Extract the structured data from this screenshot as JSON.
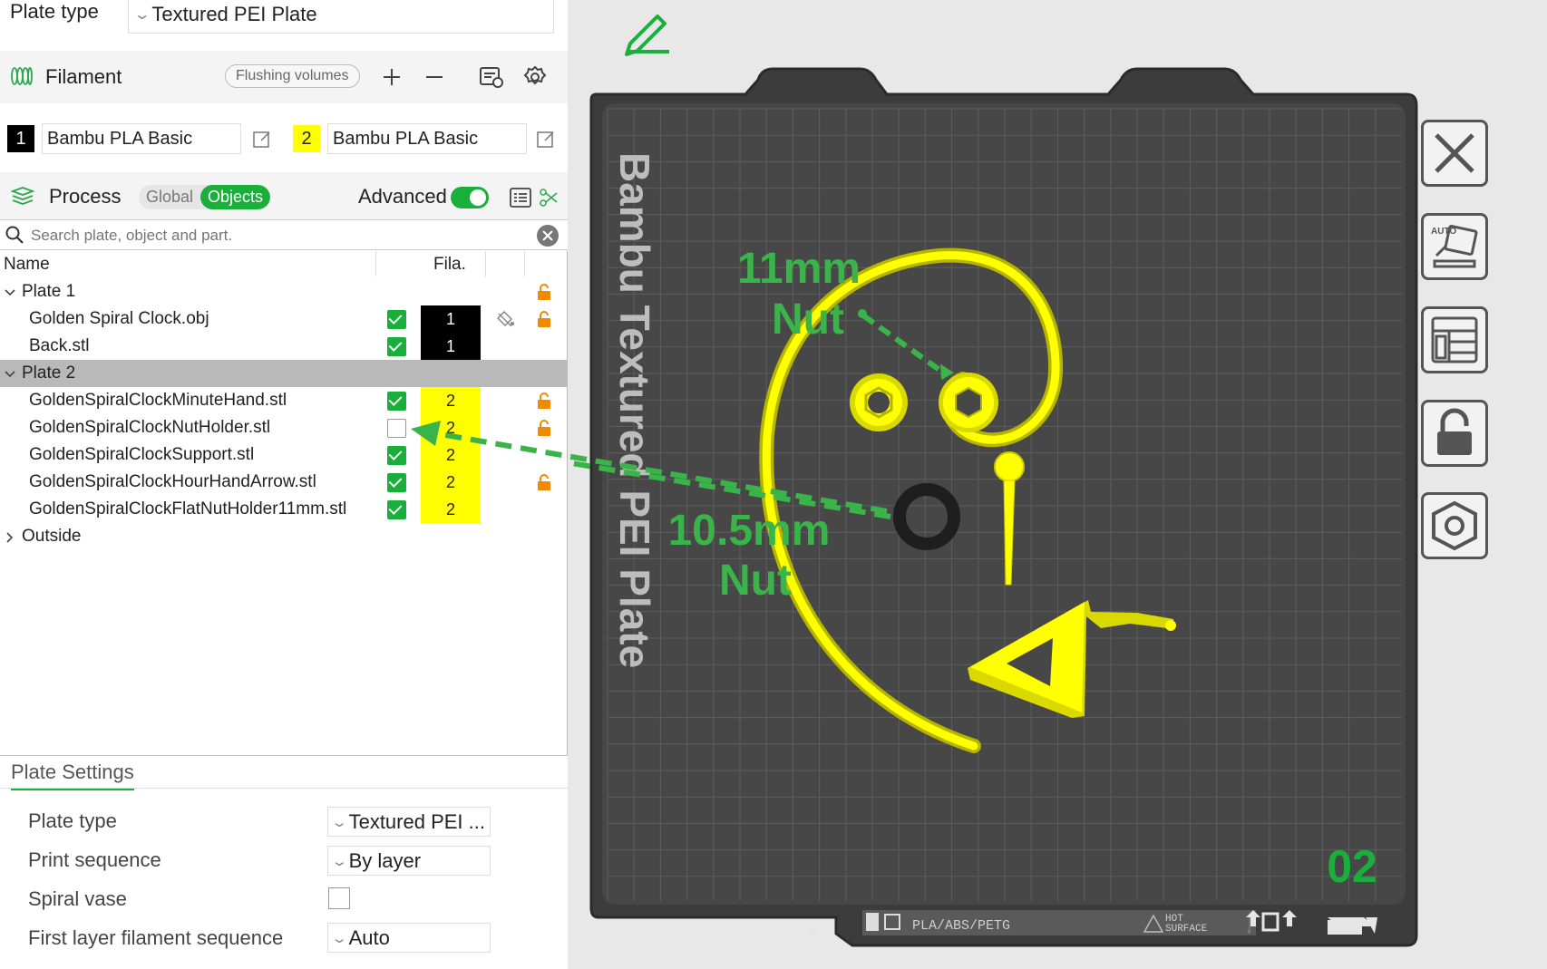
{
  "plate_type_top": {
    "label": "Plate type",
    "value": "Textured PEI Plate"
  },
  "filament": {
    "title": "Filament",
    "flushing_label": "Flushing volumes",
    "items": [
      {
        "index": "1",
        "name": "Bambu PLA Basic",
        "color": "#000000"
      },
      {
        "index": "2",
        "name": "Bambu PLA Basic",
        "color": "#ffff00"
      }
    ]
  },
  "process": {
    "title": "Process",
    "global_label": "Global",
    "objects_label": "Objects",
    "advanced_label": "Advanced"
  },
  "search": {
    "placeholder": "Search plate, object and part."
  },
  "tree": {
    "col_name": "Name",
    "col_fila": "Fila.",
    "rows": [
      {
        "name": "Plate 1",
        "type": "plate"
      },
      {
        "name": "Golden Spiral Clock.obj",
        "checked": true,
        "fila": "1"
      },
      {
        "name": "Back.stl",
        "checked": true,
        "fila": "1"
      },
      {
        "name": "Plate 2",
        "type": "plate"
      },
      {
        "name": "GoldenSpiralClockMinuteHand.stl",
        "checked": true,
        "fila": "2"
      },
      {
        "name": "GoldenSpiralClockNutHolder.stl",
        "checked": false,
        "fila": "2"
      },
      {
        "name": "GoldenSpiralClockSupport.stl",
        "checked": true,
        "fila": "2"
      },
      {
        "name": "GoldenSpiralClockHourHandArrow.stl",
        "checked": true,
        "fila": "2"
      },
      {
        "name": "GoldenSpiralClockFlatNutHolder11mm.stl",
        "checked": true,
        "fila": "2"
      },
      {
        "name": "Outside",
        "type": "group"
      }
    ]
  },
  "plate_settings": {
    "tab": "Plate Settings",
    "rows": [
      {
        "label": "Plate type",
        "value": "Textured PEI ..."
      },
      {
        "label": "Print sequence",
        "value": "By layer"
      },
      {
        "label": "Spiral vase",
        "value": ""
      },
      {
        "label": "First layer filament sequence",
        "value": "Auto"
      }
    ]
  },
  "viewport": {
    "plate_text": "Bambu Textured PEI Plate",
    "annotation_11": [
      "11mm",
      "Nut"
    ],
    "annotation_105": [
      "10.5mm",
      "Nut"
    ],
    "plate_number": "02",
    "bed_label": "PLA/ABS/PETG",
    "hot_surface": [
      "HOT",
      "SURFACE"
    ],
    "auto_label": "AUTO",
    "accent": "#1aae3b",
    "annotation_color": "#3ab44a",
    "model_color": "#ffff00"
  }
}
